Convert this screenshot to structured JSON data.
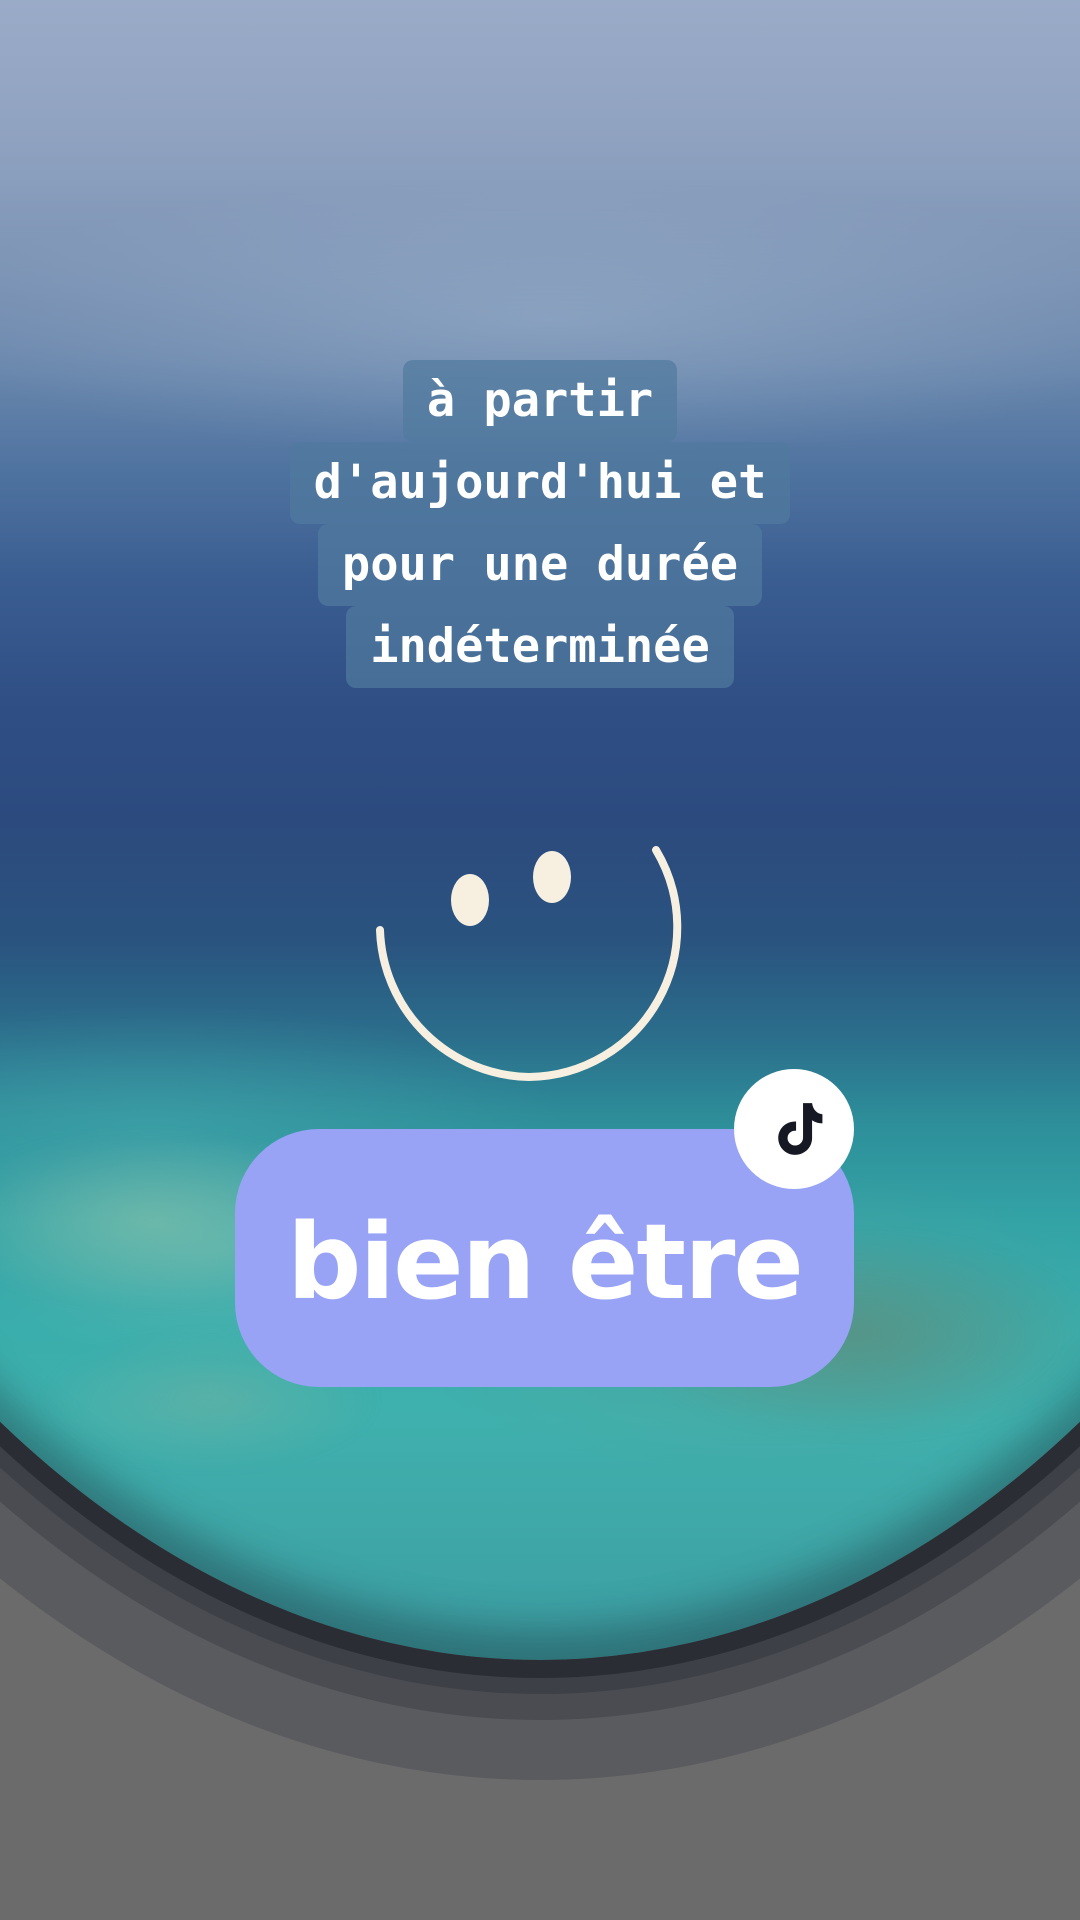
{
  "caption": {
    "lines": [
      "à partir",
      "d'aujourd'hui et",
      "pour une durée",
      "indéterminée"
    ]
  },
  "sticker": {
    "label": "bien être",
    "color": "#98a3f6"
  },
  "icons": {
    "smiley": "smiley-face-icon",
    "badge": "tiktok-logo-icon"
  },
  "colors": {
    "caption_background": "#507a9e",
    "smiley_stroke": "#f7f0e1"
  }
}
